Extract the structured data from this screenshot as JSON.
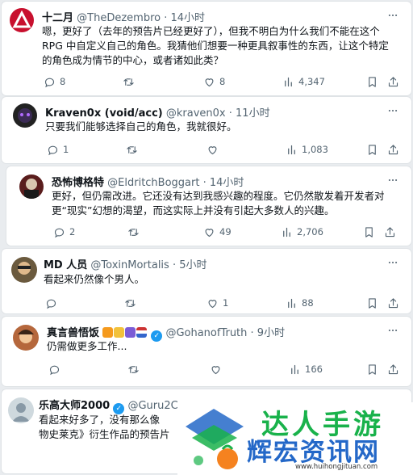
{
  "tweets": [
    {
      "name": "十二月",
      "handle": "@TheDezembro",
      "time": "· 14小时",
      "lines": [
        "嗯，更好了（去年的预告片已经更好了），但我不明白为什么我们不能在这个",
        "RPG 中自定义自己的角色。我猜他们想要一种更具叙事性的东西，让这个特定",
        "的角色成为情节的中心，或者诸如此类？"
      ],
      "replies": "8",
      "retweets": "",
      "likes": "8",
      "views": "4,347"
    },
    {
      "name": "Kraven0x (void/acc)",
      "handle": "@kraven0x",
      "time": "· 11小时",
      "lines": [
        "只要我们能够选择自己的角色，我就很好。"
      ],
      "replies": "1",
      "retweets": "",
      "likes": "",
      "views": "1,083"
    },
    {
      "name": "恐怖博格特",
      "handle": "@EldritchBoggart",
      "time": "· 14小时",
      "lines": [
        "更好，但仍需改进。它还没有达到我感兴趣的程度。它仍然散发着开发者对",
        "更“现实”幻想的渴望，而这实际上并没有引起大多数人的兴趣。"
      ],
      "replies": "2",
      "retweets": "",
      "likes": "49",
      "views": "2,706"
    },
    {
      "name": "MD 人员",
      "handle": "@ToxinMortalis",
      "time": "· 5小时",
      "lines": [
        "看起来仍然像个男人。"
      ],
      "replies": "",
      "retweets": "",
      "likes": "1",
      "views": "88"
    },
    {
      "name": "真言兽悟饭",
      "handle": "@GohanofTruth",
      "time": "· 9小时",
      "lines": [
        "仍需做更多工作..."
      ],
      "replies": "",
      "retweets": "",
      "likes": "",
      "views": "166"
    },
    {
      "name": "乐高大师2000",
      "handle": "@Guru2C",
      "time": "",
      "lines": [
        "看起来好多了，没有那么像",
        "物史莱克》衍生作品的预告片"
      ],
      "replies": "",
      "retweets": "",
      "likes": "",
      "views": ""
    }
  ],
  "watermark": {
    "top": "达人手游",
    "main": "辉宏资讯网",
    "url": "www.huihongjituan.com"
  },
  "colors": {
    "text": "#0f1419",
    "muted": "#536471",
    "verified": "#1d9bf0",
    "background": "#e9ecef"
  },
  "icons": [
    "more-icon",
    "reply-icon",
    "retweet-icon",
    "like-icon",
    "views-icon",
    "bookmark-icon",
    "share-icon",
    "verified-icon"
  ]
}
